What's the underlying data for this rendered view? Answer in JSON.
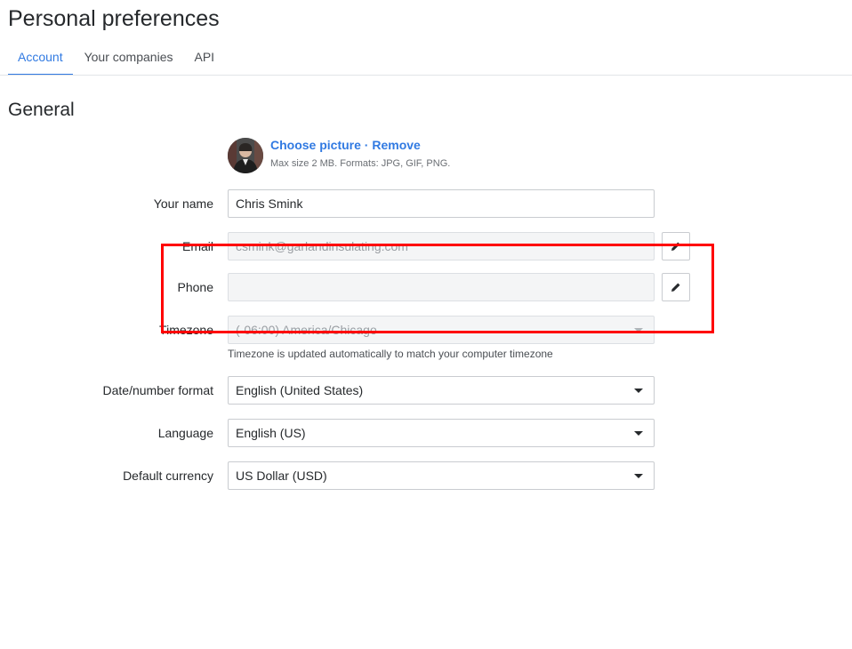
{
  "page": {
    "title": "Personal preferences"
  },
  "tabs": [
    {
      "label": "Account",
      "active": true
    },
    {
      "label": "Your companies",
      "active": false
    },
    {
      "label": "API",
      "active": false
    }
  ],
  "section": {
    "title": "General"
  },
  "picture": {
    "choose_label": "Choose picture",
    "separator": "·",
    "remove_label": "Remove",
    "hint": "Max size 2 MB. Formats: JPG, GIF, PNG."
  },
  "form": {
    "name": {
      "label": "Your name",
      "value": "Chris Smink"
    },
    "email": {
      "label": "Email",
      "value": "csmink@garlandinsulating.com",
      "edit_icon": "pencil-icon"
    },
    "phone": {
      "label": "Phone",
      "value": "",
      "edit_icon": "pencil-icon"
    },
    "timezone": {
      "label": "Timezone",
      "value": "(-06:00) America/Chicago",
      "hint": "Timezone is updated automatically to match your computer timezone"
    },
    "date_format": {
      "label": "Date/number format",
      "value": "English (United States)"
    },
    "language": {
      "label": "Language",
      "value": "English (US)"
    },
    "currency": {
      "label": "Default currency",
      "value": "US Dollar (USD)"
    }
  },
  "colors": {
    "accent": "#317ae2",
    "highlight": "#ff0000"
  }
}
